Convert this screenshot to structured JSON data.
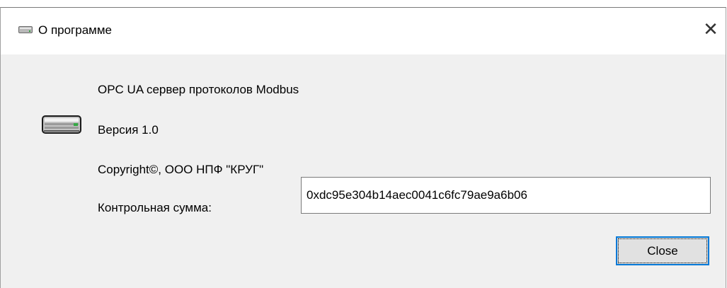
{
  "window": {
    "title": "О программе",
    "close_glyph": "✕",
    "title_icon": "device-icon",
    "app_icon": "device-icon"
  },
  "about": {
    "product": "OPC UA сервер протоколов Modbus",
    "version": "Версия 1.0",
    "copyright": "Copyright©, ООО НПФ \"КРУГ\"",
    "checksum_label": "Контрольная сумма:",
    "checksum_value": "0xdc95e304b14aec0041c6fc79ae9a6b06"
  },
  "buttons": {
    "close_label": "Close"
  },
  "colors": {
    "dialog_bg": "#f0f0f0",
    "titlebar_bg": "#ffffff",
    "focus_accent": "#0078d7",
    "button_bg": "#e1e1e1"
  }
}
